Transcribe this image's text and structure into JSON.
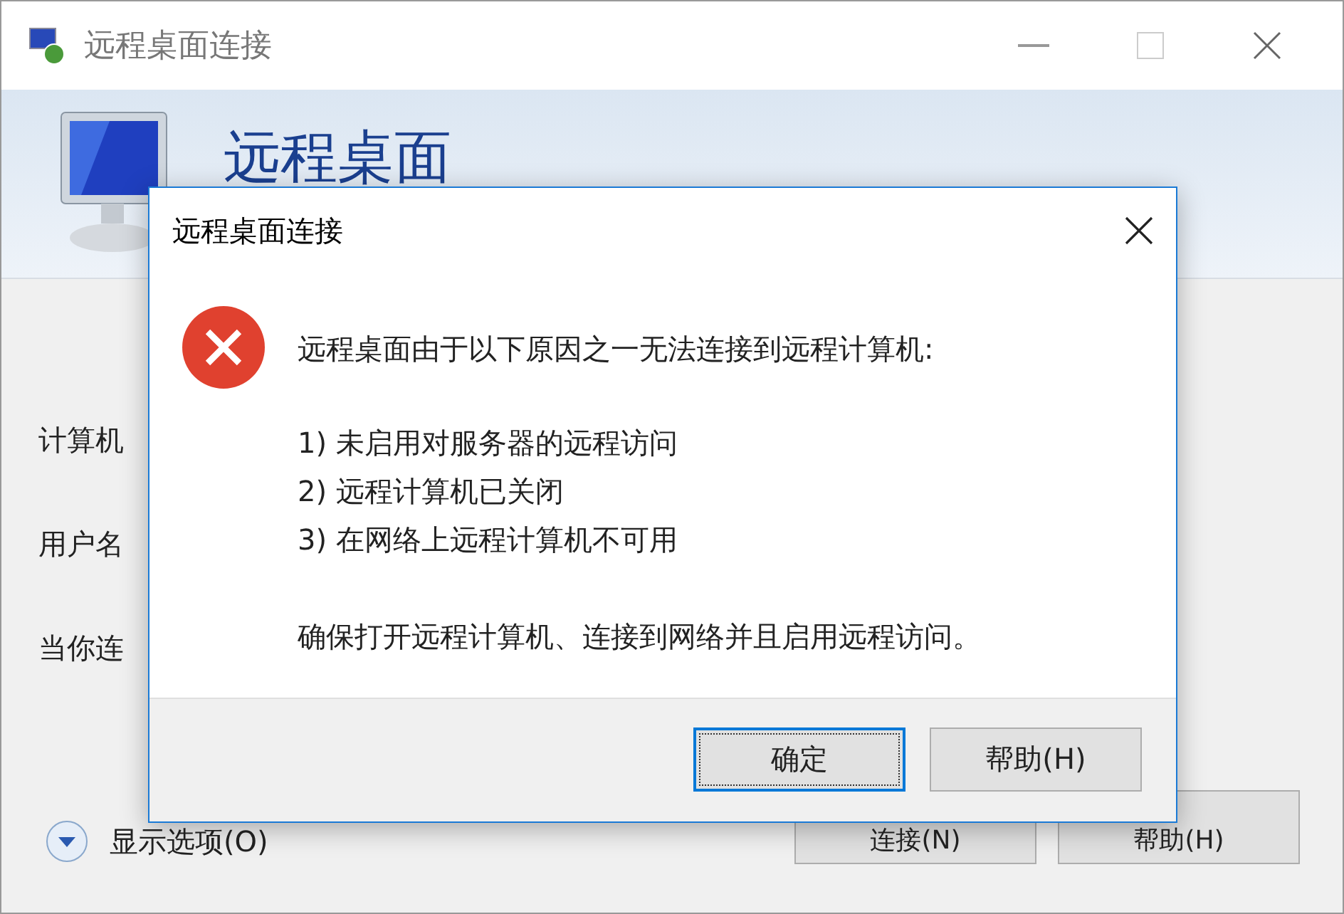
{
  "window": {
    "title": "远程桌面连接",
    "header": "远程桌面"
  },
  "fields": [
    {
      "label": "计算机"
    },
    {
      "label": "用户名"
    },
    {
      "label": "当你连"
    }
  ],
  "show_options": {
    "label": "显示选项(O)",
    "expanded": false
  },
  "window_buttons": [
    {
      "label": "连接(N)"
    },
    {
      "label": "帮助(H)"
    }
  ],
  "dialog": {
    "title": "远程桌面连接",
    "message": "远程桌面由于以下原因之一无法连接到远程计算机:",
    "reasons": [
      "1) 未启用对服务器的远程访问",
      "2) 远程计算机已关闭",
      "3) 在网络上远程计算机不可用"
    ],
    "advice": "确保打开远程计算机、连接到网络并且启用远程访问。",
    "buttons": [
      {
        "label": "确定",
        "selected": true
      },
      {
        "label": "帮助(H)",
        "selected": false
      }
    ]
  }
}
